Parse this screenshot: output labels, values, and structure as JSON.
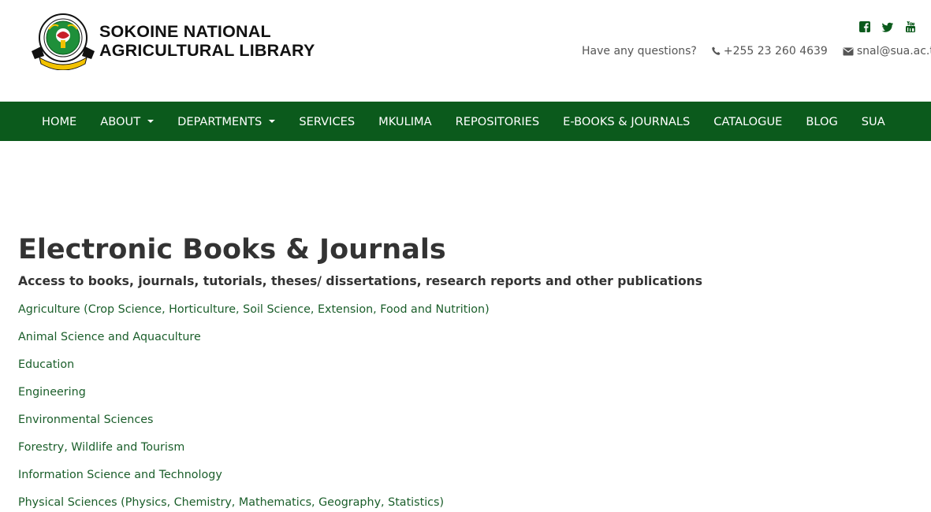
{
  "header": {
    "logo_line1": "SOKOINE NATIONAL",
    "logo_line2": "AGRICULTURAL LIBRARY",
    "social": [
      "facebook-icon",
      "twitter-icon",
      "youtube-icon"
    ],
    "questions": "Have any questions?",
    "phone": "+255 23 260 4639",
    "email": "snal@sua.ac.tz"
  },
  "nav": {
    "items": [
      {
        "label": "HOME",
        "dropdown": false
      },
      {
        "label": "ABOUT",
        "dropdown": true
      },
      {
        "label": "DEPARTMENTS",
        "dropdown": true
      },
      {
        "label": "SERVICES",
        "dropdown": false
      },
      {
        "label": "MKULIMA",
        "dropdown": false
      },
      {
        "label": "REPOSITORIES",
        "dropdown": false
      },
      {
        "label": "E-BOOKS & JOURNALS",
        "dropdown": false
      },
      {
        "label": "CATALOGUE",
        "dropdown": false
      },
      {
        "label": "BLOG",
        "dropdown": false
      },
      {
        "label": "SUA",
        "dropdown": false
      }
    ]
  },
  "main": {
    "title": "Electronic Books & Journals",
    "subtitle": "Access to books, journals, tutorials, theses/ dissertations, research reports and other publications",
    "links": [
      "Agriculture (Crop Science, Horticulture, Soil Science, Extension, Food and Nutrition)",
      "Animal Science and Aquaculture",
      "Education",
      "Engineering",
      "Environmental Sciences",
      "Forestry, Wildlife and Tourism",
      "Information Science and Technology",
      "Physical Sciences (Physics, Chemistry, Mathematics, Geography, Statistics)"
    ]
  },
  "colors": {
    "brand_green": "#0b5a1c",
    "link_green": "#1a5e2a",
    "text_dark": "#333333"
  }
}
